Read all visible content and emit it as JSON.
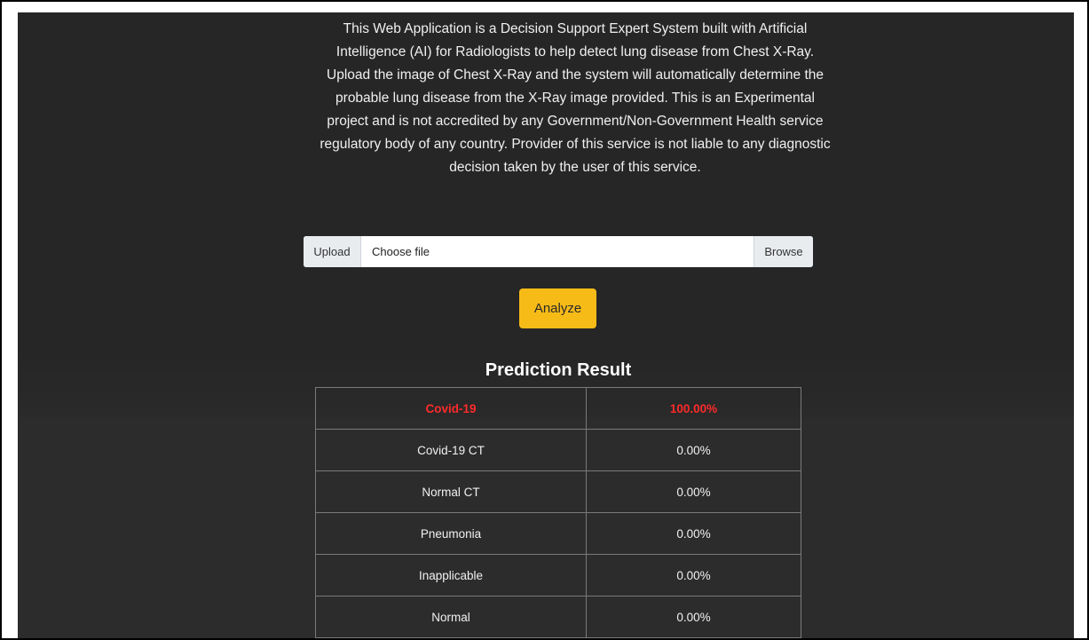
{
  "description": "This Web Application is a Decision Support Expert System built with Artificial Intelligence (AI) for Radiologists to help detect lung disease from Chest X-Ray. Upload the image of Chest X-Ray and the system will automatically determine the probable lung disease from the X-Ray image provided. This is an Experimental project and is not accredited by any Government/Non-Government Health service regulatory body of any country. Provider of this service is not liable to any diagnostic decision taken by the user of this service.",
  "upload": {
    "prefix": "Upload",
    "placeholder": "Choose file",
    "browse_label": "Browse"
  },
  "analyze_label": "Analyze",
  "result": {
    "title": "Prediction Result",
    "rows": [
      {
        "label": "Covid-19",
        "value": "100.00%",
        "highlight": true
      },
      {
        "label": "Covid-19 CT",
        "value": "0.00%"
      },
      {
        "label": "Normal CT",
        "value": "0.00%"
      },
      {
        "label": "Pneumonia",
        "value": "0.00%"
      },
      {
        "label": "Inapplicable",
        "value": "0.00%"
      },
      {
        "label": "Normal",
        "value": "0.00%"
      }
    ]
  },
  "colors": {
    "page_background": "#262626",
    "accent": "#f7bb17",
    "highlight_text": "#ff2a2a",
    "table_border": "#7a7a7a"
  }
}
